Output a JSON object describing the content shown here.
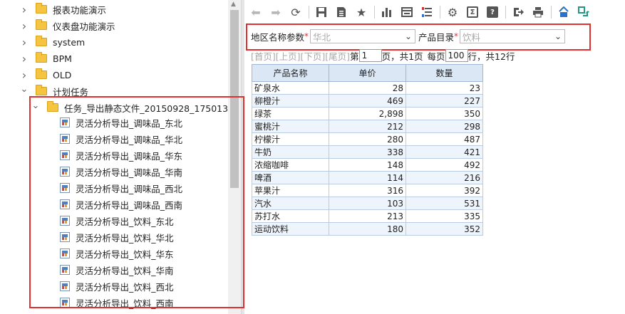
{
  "tree": {
    "nodes": [
      {
        "label": "报表功能演示",
        "type": "folder",
        "expanded": false
      },
      {
        "label": "仪表盘功能演示",
        "type": "folder",
        "expanded": false
      },
      {
        "label": "system",
        "type": "folder",
        "expanded": false
      },
      {
        "label": "BPM",
        "type": "folder",
        "expanded": false
      },
      {
        "label": "OLD",
        "type": "folder",
        "expanded": false
      },
      {
        "label": "计划任务",
        "type": "folder",
        "expanded": true
      },
      {
        "label": "任务_导出静态文件_20150928_175013",
        "type": "folder",
        "expanded": true
      },
      {
        "label": "灵活分析导出_调味品_东北",
        "type": "report"
      },
      {
        "label": "灵活分析导出_调味品_华北",
        "type": "report"
      },
      {
        "label": "灵活分析导出_调味品_华东",
        "type": "report"
      },
      {
        "label": "灵活分析导出_调味品_华南",
        "type": "report"
      },
      {
        "label": "灵活分析导出_调味品_西北",
        "type": "report"
      },
      {
        "label": "灵活分析导出_调味品_西南",
        "type": "report"
      },
      {
        "label": "灵活分析导出_饮料_东北",
        "type": "report"
      },
      {
        "label": "灵活分析导出_饮料_华北",
        "type": "report"
      },
      {
        "label": "灵活分析导出_饮料_华东",
        "type": "report"
      },
      {
        "label": "灵活分析导出_饮料_华南",
        "type": "report"
      },
      {
        "label": "灵活分析导出_饮料_西北",
        "type": "report"
      },
      {
        "label": "灵活分析导出_饮料_西南",
        "type": "report"
      }
    ]
  },
  "toolbar": {
    "icons": [
      "back-arrow-icon",
      "forward-arrow-icon",
      "refresh-icon",
      "save-icon",
      "save-as-icon",
      "favorite-star-icon",
      "bar-chart-icon",
      "table-view-icon",
      "filter-icon",
      "settings-gear-icon",
      "sigma-sum-icon",
      "help-icon",
      "export-icon",
      "print-icon",
      "format-icon",
      "switch-icon"
    ]
  },
  "params": {
    "region_label": "地区名称参数",
    "region_required": "*",
    "region_value": "华北",
    "catalog_label": "产品目录",
    "catalog_required": "*",
    "catalog_value": "饮料"
  },
  "pager": {
    "first": "[首页]",
    "prev": "[上页]",
    "next": "[下页]",
    "last": "[尾页]",
    "page_prefix": "第",
    "page_value": "1",
    "page_suffix": "页，共1页",
    "per_page_prefix": "每页",
    "per_page_value": "100",
    "per_page_suffix": "行，共12行"
  },
  "table": {
    "headers": [
      "产品名称",
      "单价",
      "数量"
    ],
    "rows": [
      [
        "矿泉水",
        "28",
        "23"
      ],
      [
        "柳橙汁",
        "469",
        "227"
      ],
      [
        "绿茶",
        "2,898",
        "350"
      ],
      [
        "蜜桃汁",
        "212",
        "298"
      ],
      [
        "柠檬汁",
        "280",
        "487"
      ],
      [
        "牛奶",
        "338",
        "421"
      ],
      [
        "浓缩咖啡",
        "148",
        "492"
      ],
      [
        "啤酒",
        "114",
        "216"
      ],
      [
        "苹果汁",
        "316",
        "392"
      ],
      [
        "汽水",
        "103",
        "531"
      ],
      [
        "苏打水",
        "213",
        "335"
      ],
      [
        "运动饮料",
        "180",
        "352"
      ]
    ]
  },
  "colors": {
    "highlight_border": "#e03030",
    "header_bg": "#dbe7f5",
    "row_alt_bg": "#eef4fb"
  }
}
